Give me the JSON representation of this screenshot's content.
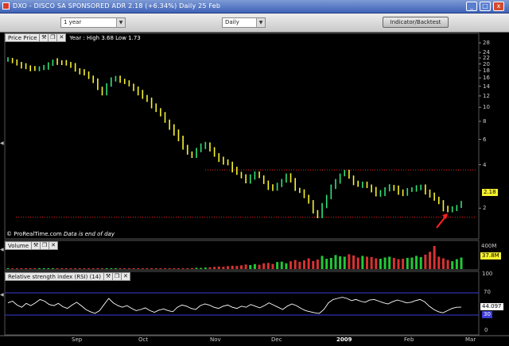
{
  "window": {
    "title": "DXO - DISCO SA SPONSORED ADR   2.18  (+6.34%)   Daily  25 Feb",
    "minimize_glyph": "_",
    "maximize_glyph": "□",
    "close_glyph": "x"
  },
  "toolbar": {
    "period": "1 year",
    "interval": "Daily",
    "indicator_button": "Indicator/Backtest",
    "dropdown_glyph": "▼"
  },
  "price_panel": {
    "label": "Price Price",
    "info": "Year : High 3.68 Low 1.73",
    "current_price": "2.18",
    "y_ticks": [
      "28",
      "24",
      "22",
      "20",
      "18",
      "16",
      "14",
      "12",
      "10",
      "8",
      "6",
      "4",
      "2"
    ],
    "watermark_brand": "© ProRealTime.com",
    "watermark_note": "Data is end of day",
    "support_level_color": "#ff2020",
    "bull_color": "#32e07a",
    "bear_color": "#f7f22e",
    "arrow_color": "#ff2020"
  },
  "volume_panel": {
    "label": "Volume",
    "current_volume": "37.8M",
    "y_ticks": [
      "400M"
    ],
    "up_color": "#22c838",
    "down_color": "#d83232"
  },
  "rsi_panel": {
    "label": "Relative strength index (RSI) (14)",
    "current_value": "44.097",
    "y_ticks": [
      "100",
      "70",
      "30",
      "0"
    ],
    "oversold_tag": "30",
    "line_color": "#ffffff",
    "band_color": "#3b3bd8"
  },
  "panel_buttons": [
    "⚒",
    "❐",
    "✕"
  ],
  "x_axis": {
    "labels": [
      {
        "text": "Sep",
        "bold": false
      },
      {
        "text": "Oct",
        "bold": false
      },
      {
        "text": "Nov",
        "bold": false
      },
      {
        "text": "Dec",
        "bold": false
      },
      {
        "text": "2009",
        "bold": true
      },
      {
        "text": "Feb",
        "bold": false
      },
      {
        "text": "Mar",
        "bold": false
      }
    ]
  },
  "chart_data": {
    "type": "ohlc",
    "period": "1 year daily",
    "price_y_scale": "log",
    "price_ylim": [
      1.5,
      28
    ],
    "support_line": 1.73,
    "resistance_line": 3.68,
    "price_series": [
      21.5,
      20.8,
      20.2,
      19.5,
      19.0,
      18.6,
      18.3,
      18.6,
      18.9,
      19.8,
      20.9,
      20.7,
      20.3,
      20.0,
      19.5,
      18.2,
      17.8,
      17.1,
      16.2,
      15.4,
      13.6,
      12.7,
      14.3,
      15.6,
      15.9,
      15.4,
      14.9,
      14.3,
      13.4,
      12.6,
      11.8,
      11.3,
      10.3,
      9.6,
      8.9,
      8.0,
      7.3,
      6.7,
      6.1,
      5.3,
      4.8,
      4.6,
      5.1,
      5.4,
      5.6,
      5.1,
      4.7,
      4.4,
      4.2,
      4.1,
      3.7,
      3.5,
      3.3,
      3.1,
      3.3,
      3.5,
      3.3,
      3.0,
      2.8,
      2.7,
      2.9,
      3.1,
      3.4,
      3.1,
      2.7,
      2.6,
      2.4,
      2.2,
      1.9,
      1.78,
      2.1,
      2.4,
      2.8,
      3.1,
      3.4,
      3.6,
      3.3,
      3.0,
      2.9,
      2.95,
      2.85,
      2.7,
      2.5,
      2.55,
      2.7,
      2.8,
      2.75,
      2.6,
      2.55,
      2.65,
      2.7,
      2.75,
      2.8,
      2.6,
      2.45,
      2.35,
      2.2,
      2.0,
      1.92,
      1.98,
      2.05,
      2.18
    ],
    "volume_series": [
      2,
      3,
      2,
      2,
      3,
      2,
      3,
      2,
      2,
      3,
      2,
      3,
      2,
      2,
      3,
      2,
      2,
      3,
      2,
      2,
      3,
      2,
      3,
      2,
      2,
      3,
      2,
      3,
      2,
      3,
      3,
      2,
      3,
      4,
      3,
      4,
      5,
      4,
      6,
      8,
      10,
      12,
      15,
      14,
      18,
      22,
      26,
      30,
      28,
      35,
      40,
      38,
      45,
      55,
      48,
      60,
      52,
      70,
      75,
      62,
      85,
      90,
      70,
      95,
      110,
      88,
      105,
      130,
      98,
      115,
      160,
      125,
      135,
      170,
      155,
      150,
      180,
      165,
      140,
      160,
      150,
      145,
      130,
      125,
      140,
      150,
      135,
      120,
      125,
      135,
      140,
      160,
      145,
      175,
      210,
      280,
      150,
      130,
      110,
      95,
      120,
      140
    ],
    "rsi_series": [
      52,
      55,
      48,
      44,
      51,
      47,
      52,
      58,
      55,
      49,
      47,
      51,
      45,
      42,
      48,
      53,
      47,
      40,
      36,
      33,
      38,
      49,
      60,
      52,
      47,
      44,
      47,
      42,
      38,
      40,
      43,
      38,
      35,
      39,
      41,
      38,
      36,
      44,
      48,
      46,
      42,
      40,
      47,
      50,
      48,
      44,
      42,
      46,
      48,
      44,
      42,
      46,
      44,
      49,
      46,
      43,
      47,
      52,
      48,
      44,
      40,
      46,
      50,
      47,
      42,
      38,
      36,
      34,
      33,
      40,
      52,
      58,
      60,
      62,
      60,
      56,
      58,
      55,
      53,
      57,
      58,
      55,
      52,
      50,
      54,
      57,
      55,
      52,
      53,
      56,
      58,
      54,
      46,
      40,
      36,
      34,
      38,
      42,
      44,
      44.1
    ],
    "rsi_levels": [
      70,
      30
    ]
  }
}
